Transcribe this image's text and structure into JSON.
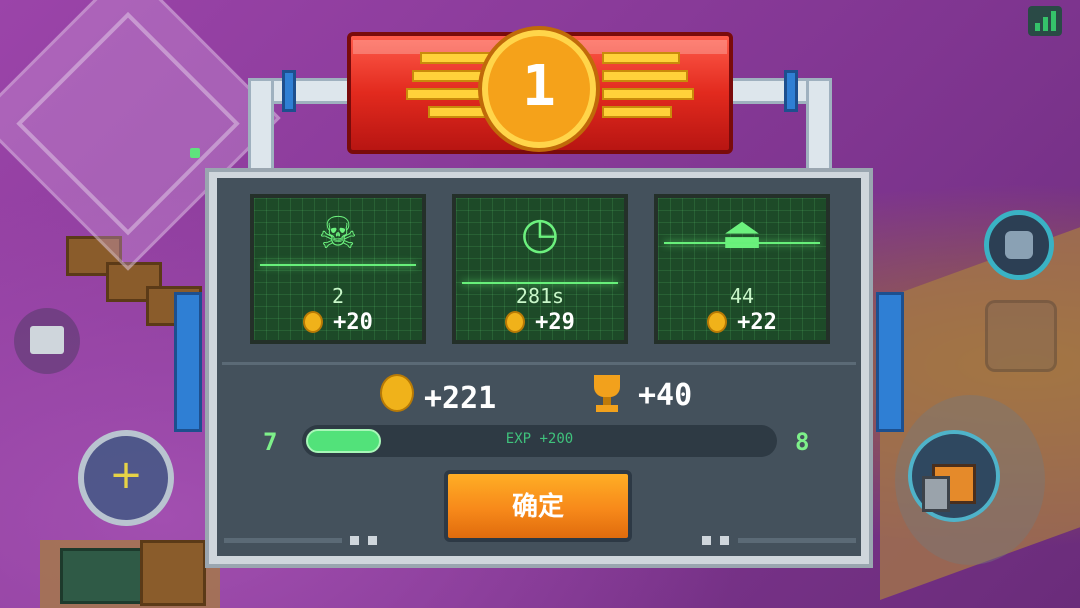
{
  "rank": "1",
  "stats": [
    {
      "icon": "☠",
      "value": "2",
      "coins": "+20"
    },
    {
      "icon": "◷",
      "value": "281s",
      "coins": "+29"
    },
    {
      "icon": "⏏",
      "value": "44",
      "coins": "+22"
    }
  ],
  "totals": {
    "coins": "+221",
    "trophies": "+40"
  },
  "exp": {
    "current_level": "7",
    "next_level": "8",
    "label": "EXP +200",
    "progress": 0.16
  },
  "confirm_label": "确定",
  "colors": {
    "accent_green": "#6cf17e",
    "confirm_orange": "#f7891a",
    "banner_red": "#e22a1e",
    "medal_gold": "#f5a21a"
  }
}
